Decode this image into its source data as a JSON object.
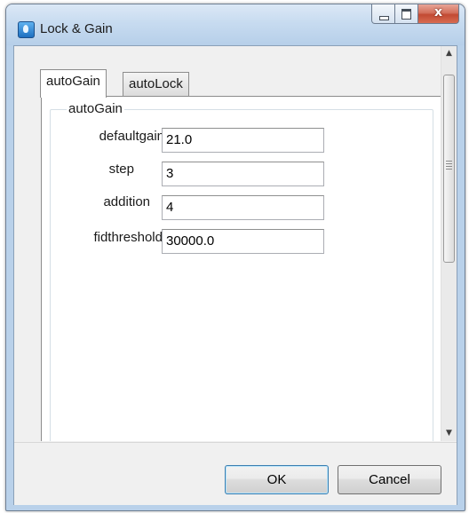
{
  "window": {
    "title": "Lock & Gain",
    "icon": "app-icon",
    "controls": [
      "minimize-icon",
      "maximize-icon",
      "close-icon"
    ],
    "close_glyph": "x"
  },
  "tabs": [
    {
      "label": "autoGain",
      "active": true
    },
    {
      "label": "autoLock",
      "active": false
    }
  ],
  "group": {
    "title": "autoGain",
    "fields": [
      {
        "label": "defaultgain",
        "value": "21.0"
      },
      {
        "label": "step",
        "value": "3"
      },
      {
        "label": "addition",
        "value": "4"
      },
      {
        "label": "fidthreshold",
        "value": "30000.0"
      }
    ]
  },
  "buttons": {
    "ok": "OK",
    "cancel": "Cancel"
  },
  "scrollbar": {
    "up_arrow": "▲",
    "down_arrow": "▼"
  }
}
